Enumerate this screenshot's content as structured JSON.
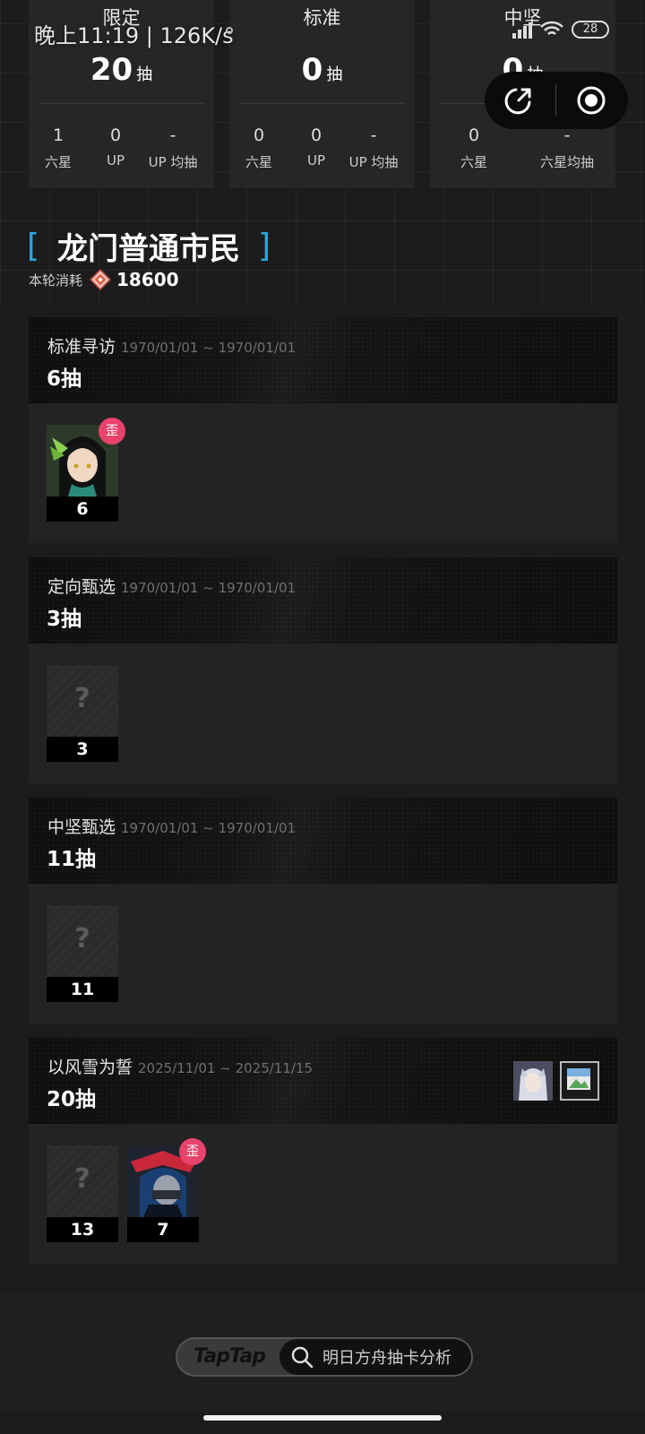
{
  "status_bar": {
    "time": "晚上11:19 | 126K/s",
    "battery": "28"
  },
  "stats": [
    {
      "title": "限定",
      "count": "20",
      "unit": "抽",
      "sub": [
        {
          "value": "1",
          "label": "六星"
        },
        {
          "value": "0",
          "label": "UP"
        },
        {
          "value": "-",
          "label": "UP 均抽"
        }
      ]
    },
    {
      "title": "标准",
      "count": "0",
      "unit": "抽",
      "sub": [
        {
          "value": "0",
          "label": "六星"
        },
        {
          "value": "0",
          "label": "UP"
        },
        {
          "value": "-",
          "label": "UP 均抽"
        }
      ]
    },
    {
      "title": "中坚",
      "count": "0",
      "unit": "抽",
      "sub": [
        {
          "value": "0",
          "label": "六星"
        },
        {
          "value": "-",
          "label": "六星均抽"
        }
      ]
    }
  ],
  "rank": {
    "title": "龙门普通市民",
    "cost_label": "本轮消耗",
    "cost_value": "18600"
  },
  "pools": [
    {
      "name": "标准寻访",
      "dates": "1970/01/01 ~ 1970/01/01",
      "pulls": "6抽",
      "operators": [
        {
          "count": "6",
          "badge": "歪",
          "known": true
        }
      ]
    },
    {
      "name": "定向甄选",
      "dates": "1970/01/01 ~ 1970/01/01",
      "pulls": "3抽",
      "operators": [
        {
          "count": "3",
          "placeholder": "?",
          "known": false
        }
      ]
    },
    {
      "name": "中坚甄选",
      "dates": "1970/01/01 ~ 1970/01/01",
      "pulls": "11抽",
      "operators": [
        {
          "count": "11",
          "placeholder": "?",
          "known": false
        }
      ]
    },
    {
      "name": "以风雪为誓",
      "dates": "2025/11/01 ~ 2025/11/15",
      "pulls": "20抽",
      "operators": [
        {
          "count": "13",
          "placeholder": "?",
          "known": false
        },
        {
          "count": "7",
          "badge": "歪",
          "known": true
        }
      ]
    }
  ],
  "footer": {
    "brand": "TapTap",
    "search_text": "明日方舟抽卡分析"
  },
  "colors": {
    "accent": "#27a9e1",
    "badge": "#e8436a"
  }
}
